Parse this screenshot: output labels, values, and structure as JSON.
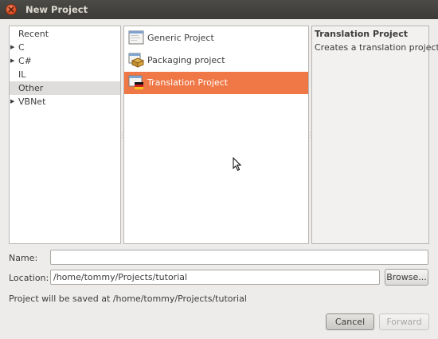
{
  "window": {
    "title": "New Project"
  },
  "categories": [
    {
      "label": "Recent",
      "expander": false,
      "selected": false
    },
    {
      "label": "C",
      "expander": true,
      "selected": false
    },
    {
      "label": "C#",
      "expander": true,
      "selected": false
    },
    {
      "label": "IL",
      "expander": false,
      "selected": false
    },
    {
      "label": "Other",
      "expander": false,
      "selected": true
    },
    {
      "label": "VBNet",
      "expander": true,
      "selected": false
    }
  ],
  "templates": [
    {
      "label": "Generic Project",
      "icon": "generic-project-icon",
      "selected": false
    },
    {
      "label": "Packaging project",
      "icon": "packaging-project-icon",
      "selected": false
    },
    {
      "label": "Translation Project",
      "icon": "translation-project-icon",
      "selected": true
    }
  ],
  "description": {
    "title": "Translation Project",
    "text": "Creates a translation project"
  },
  "form": {
    "name_label": "Name:",
    "name_value": "",
    "location_label": "Location:",
    "location_value": "/home/tommy/Projects/tutorial",
    "browse_label": "Browse..."
  },
  "status_text": "Project will be saved at /home/tommy/Projects/tutorial",
  "buttons": {
    "cancel": "Cancel",
    "forward": "Forward"
  },
  "colors": {
    "selection": "#f07746",
    "titlebar": "#3c3b37",
    "close_button": "#e0552b"
  }
}
